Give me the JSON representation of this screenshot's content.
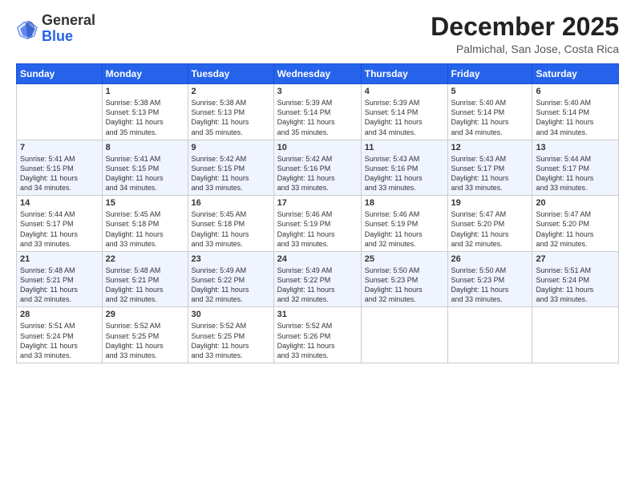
{
  "header": {
    "logo_general": "General",
    "logo_blue": "Blue",
    "month_title": "December 2025",
    "subtitle": "Palmichal, San Jose, Costa Rica"
  },
  "weekdays": [
    "Sunday",
    "Monday",
    "Tuesday",
    "Wednesday",
    "Thursday",
    "Friday",
    "Saturday"
  ],
  "weeks": [
    [
      {
        "day": "",
        "info": ""
      },
      {
        "day": "1",
        "info": "Sunrise: 5:38 AM\nSunset: 5:13 PM\nDaylight: 11 hours\nand 35 minutes."
      },
      {
        "day": "2",
        "info": "Sunrise: 5:38 AM\nSunset: 5:13 PM\nDaylight: 11 hours\nand 35 minutes."
      },
      {
        "day": "3",
        "info": "Sunrise: 5:39 AM\nSunset: 5:14 PM\nDaylight: 11 hours\nand 35 minutes."
      },
      {
        "day": "4",
        "info": "Sunrise: 5:39 AM\nSunset: 5:14 PM\nDaylight: 11 hours\nand 34 minutes."
      },
      {
        "day": "5",
        "info": "Sunrise: 5:40 AM\nSunset: 5:14 PM\nDaylight: 11 hours\nand 34 minutes."
      },
      {
        "day": "6",
        "info": "Sunrise: 5:40 AM\nSunset: 5:14 PM\nDaylight: 11 hours\nand 34 minutes."
      }
    ],
    [
      {
        "day": "7",
        "info": "Sunrise: 5:41 AM\nSunset: 5:15 PM\nDaylight: 11 hours\nand 34 minutes."
      },
      {
        "day": "8",
        "info": "Sunrise: 5:41 AM\nSunset: 5:15 PM\nDaylight: 11 hours\nand 34 minutes."
      },
      {
        "day": "9",
        "info": "Sunrise: 5:42 AM\nSunset: 5:15 PM\nDaylight: 11 hours\nand 33 minutes."
      },
      {
        "day": "10",
        "info": "Sunrise: 5:42 AM\nSunset: 5:16 PM\nDaylight: 11 hours\nand 33 minutes."
      },
      {
        "day": "11",
        "info": "Sunrise: 5:43 AM\nSunset: 5:16 PM\nDaylight: 11 hours\nand 33 minutes."
      },
      {
        "day": "12",
        "info": "Sunrise: 5:43 AM\nSunset: 5:17 PM\nDaylight: 11 hours\nand 33 minutes."
      },
      {
        "day": "13",
        "info": "Sunrise: 5:44 AM\nSunset: 5:17 PM\nDaylight: 11 hours\nand 33 minutes."
      }
    ],
    [
      {
        "day": "14",
        "info": "Sunrise: 5:44 AM\nSunset: 5:17 PM\nDaylight: 11 hours\nand 33 minutes."
      },
      {
        "day": "15",
        "info": "Sunrise: 5:45 AM\nSunset: 5:18 PM\nDaylight: 11 hours\nand 33 minutes."
      },
      {
        "day": "16",
        "info": "Sunrise: 5:45 AM\nSunset: 5:18 PM\nDaylight: 11 hours\nand 33 minutes."
      },
      {
        "day": "17",
        "info": "Sunrise: 5:46 AM\nSunset: 5:19 PM\nDaylight: 11 hours\nand 33 minutes."
      },
      {
        "day": "18",
        "info": "Sunrise: 5:46 AM\nSunset: 5:19 PM\nDaylight: 11 hours\nand 32 minutes."
      },
      {
        "day": "19",
        "info": "Sunrise: 5:47 AM\nSunset: 5:20 PM\nDaylight: 11 hours\nand 32 minutes."
      },
      {
        "day": "20",
        "info": "Sunrise: 5:47 AM\nSunset: 5:20 PM\nDaylight: 11 hours\nand 32 minutes."
      }
    ],
    [
      {
        "day": "21",
        "info": "Sunrise: 5:48 AM\nSunset: 5:21 PM\nDaylight: 11 hours\nand 32 minutes."
      },
      {
        "day": "22",
        "info": "Sunrise: 5:48 AM\nSunset: 5:21 PM\nDaylight: 11 hours\nand 32 minutes."
      },
      {
        "day": "23",
        "info": "Sunrise: 5:49 AM\nSunset: 5:22 PM\nDaylight: 11 hours\nand 32 minutes."
      },
      {
        "day": "24",
        "info": "Sunrise: 5:49 AM\nSunset: 5:22 PM\nDaylight: 11 hours\nand 32 minutes."
      },
      {
        "day": "25",
        "info": "Sunrise: 5:50 AM\nSunset: 5:23 PM\nDaylight: 11 hours\nand 32 minutes."
      },
      {
        "day": "26",
        "info": "Sunrise: 5:50 AM\nSunset: 5:23 PM\nDaylight: 11 hours\nand 33 minutes."
      },
      {
        "day": "27",
        "info": "Sunrise: 5:51 AM\nSunset: 5:24 PM\nDaylight: 11 hours\nand 33 minutes."
      }
    ],
    [
      {
        "day": "28",
        "info": "Sunrise: 5:51 AM\nSunset: 5:24 PM\nDaylight: 11 hours\nand 33 minutes."
      },
      {
        "day": "29",
        "info": "Sunrise: 5:52 AM\nSunset: 5:25 PM\nDaylight: 11 hours\nand 33 minutes."
      },
      {
        "day": "30",
        "info": "Sunrise: 5:52 AM\nSunset: 5:25 PM\nDaylight: 11 hours\nand 33 minutes."
      },
      {
        "day": "31",
        "info": "Sunrise: 5:52 AM\nSunset: 5:26 PM\nDaylight: 11 hours\nand 33 minutes."
      },
      {
        "day": "",
        "info": ""
      },
      {
        "day": "",
        "info": ""
      },
      {
        "day": "",
        "info": ""
      }
    ]
  ]
}
